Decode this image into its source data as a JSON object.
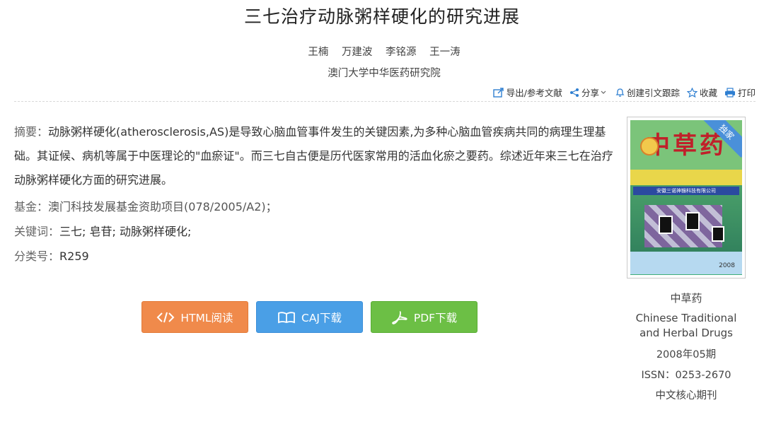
{
  "article": {
    "title": "三七治疗动脉粥样硬化的研究进展",
    "authors": [
      "王楠",
      "万建波",
      "李铭源",
      "王一涛"
    ],
    "affiliation": "澳门大学中华医药研究院"
  },
  "toolbar": {
    "export_label": "导出/参考文献",
    "share_label": "分享",
    "track_label": "创建引文跟踪",
    "favorite_label": "收藏",
    "print_label": "打印"
  },
  "abstract": {
    "label": "摘要：",
    "text": "动脉粥样硬化(atherosclerosis,AS)是导致心脑血管事件发生的关键因素,为多种心脑血管疾病共同的病理生理基础。其证候、病机等属于中医理论的\"血瘀证\"。而三七自古便是历代医家常用的活血化瘀之要药。综述近年来三七在治疗动脉粥样硬化方面的研究进展。"
  },
  "fund": {
    "label": "基金：",
    "value": "澳门科技发展基金资助项目(078/2005/A2)；"
  },
  "keywords": {
    "label": "关键词：",
    "items": [
      "三七;",
      "皂苷;",
      "动脉粥样硬化;"
    ]
  },
  "classification": {
    "label": "分类号：",
    "value": "R259"
  },
  "downloads": {
    "html_label": "HTML阅读",
    "caj_label": "CAJ下载",
    "pdf_label": "PDF下载"
  },
  "journal": {
    "cover_title": "中草药",
    "cover_badge": "独家",
    "cover_company": "安徽三诺神猴科技有限公司",
    "cover_year": "2008",
    "name_cn": "中草药",
    "name_en_line1": "Chinese Traditional",
    "name_en_line2": "and Herbal Drugs",
    "issue": "2008年05期",
    "issn": "ISSN：0253-2670",
    "core": "中文核心期刊"
  },
  "colors": {
    "html_button": "#f08a4b",
    "caj_button": "#4a9fe6",
    "pdf_button": "#6cbf45",
    "toolbar_icon": "#2f7fd1"
  },
  "icons": [
    "export-icon",
    "share-icon",
    "bell-icon",
    "star-icon",
    "printer-icon",
    "code-icon",
    "book-icon",
    "pdf-icon"
  ]
}
